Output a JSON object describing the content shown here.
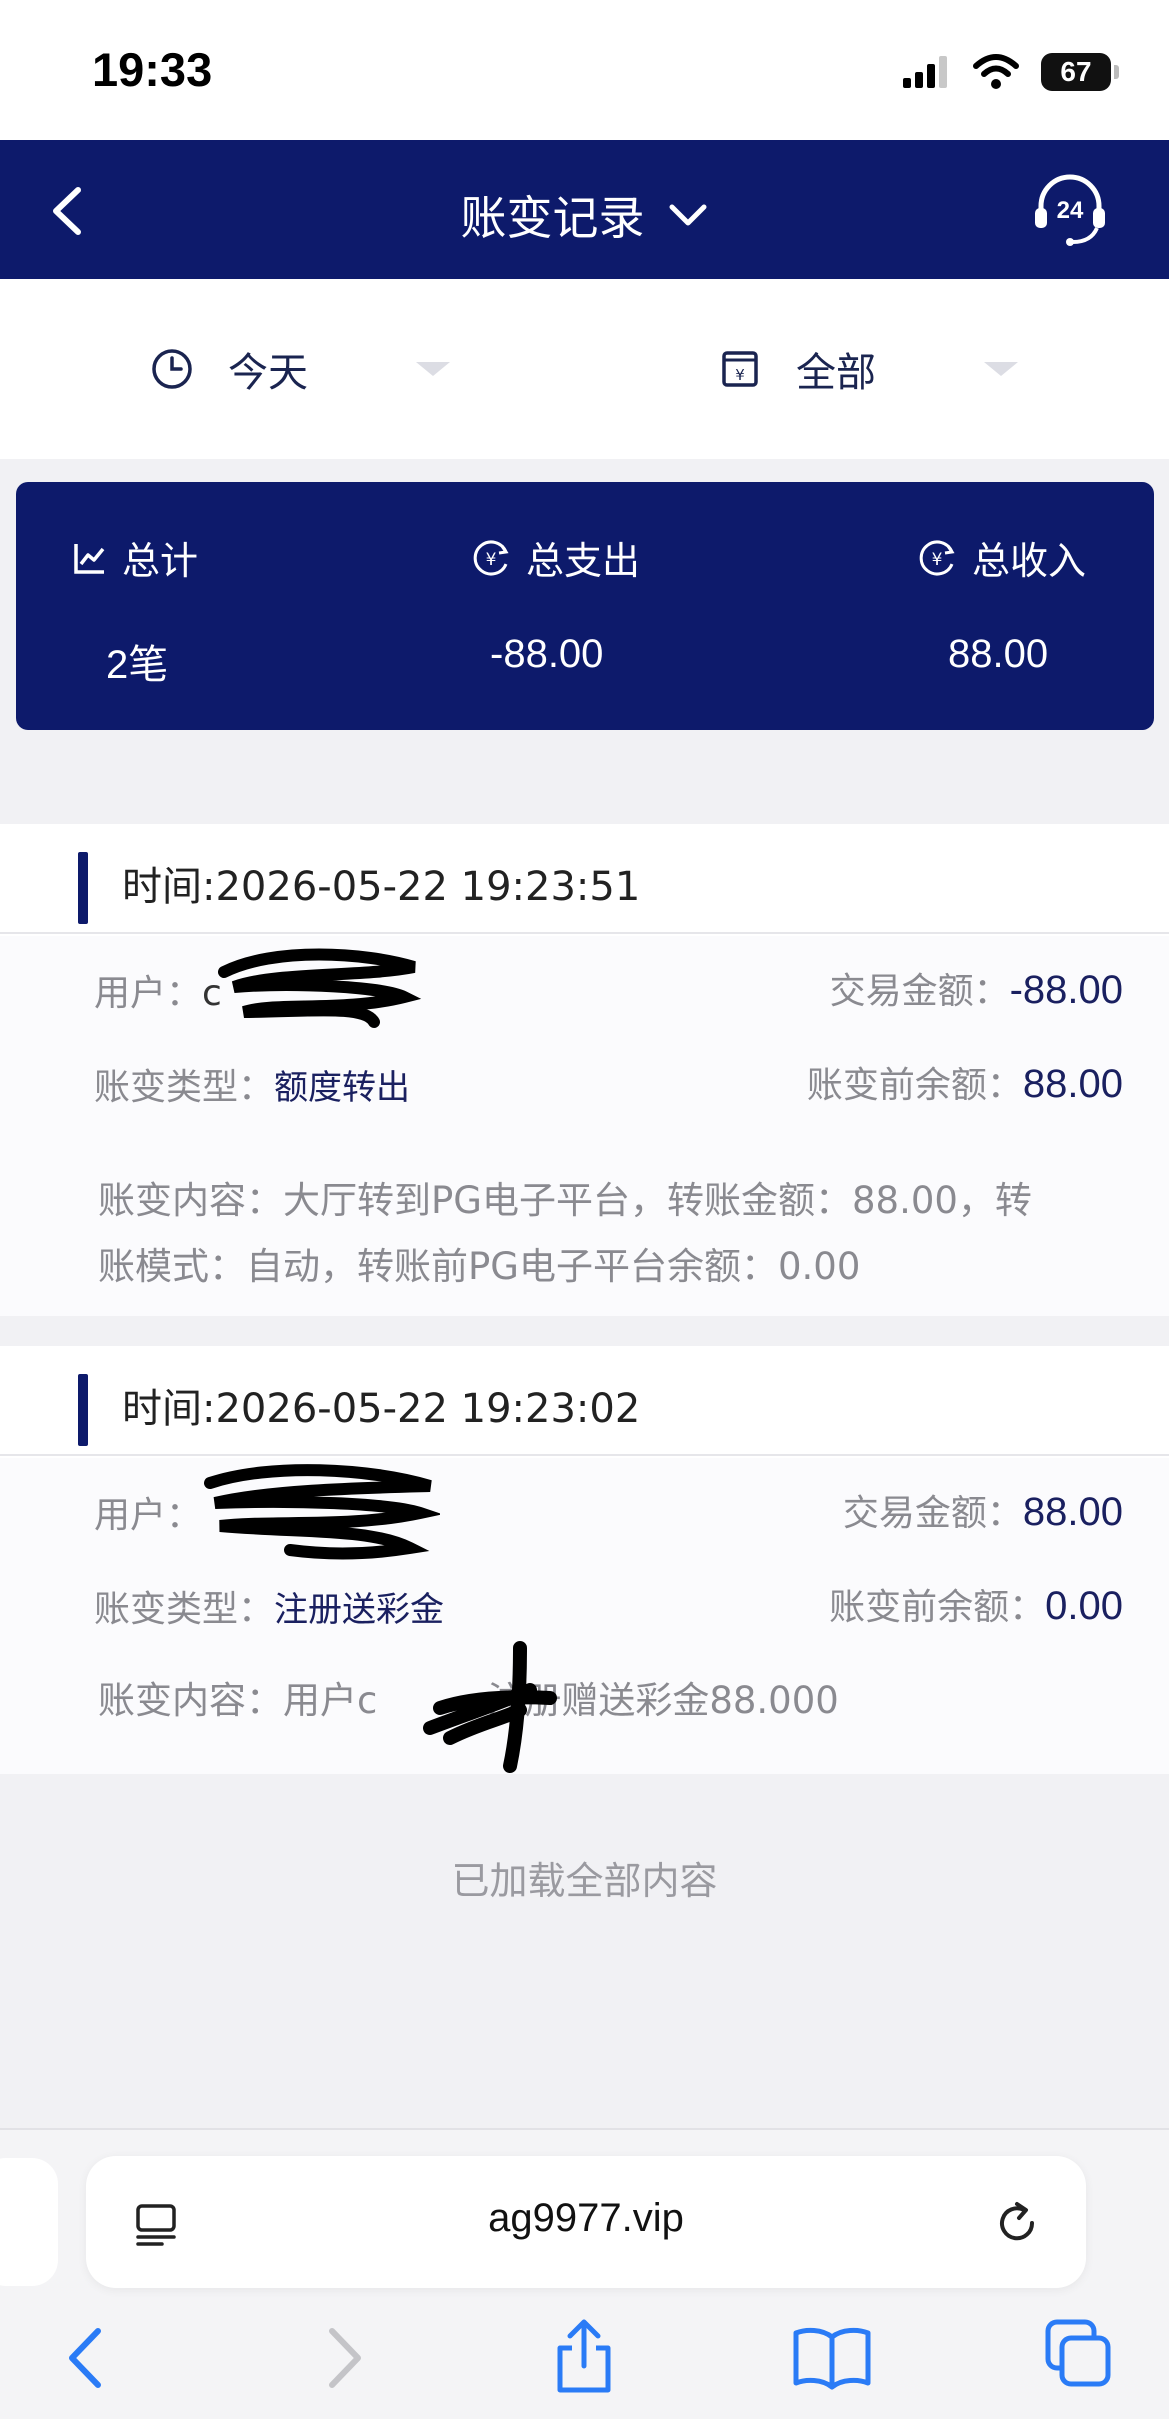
{
  "status_bar": {
    "time": "19:33",
    "battery": "67"
  },
  "header": {
    "title": "账变记录"
  },
  "filters": {
    "date_label": "今天",
    "type_label": "全部"
  },
  "summary": {
    "total_label": "总计",
    "total_value": "2笔",
    "expense_label": "总支出",
    "expense_value": "-88.00",
    "income_label": "总收入",
    "income_value": "88.00"
  },
  "records": [
    {
      "time": "时间:2026-05-22 19:23:51",
      "user_label": "用户：",
      "user_value": "c",
      "amount_label": "交易金额：",
      "amount_value": "-88.00",
      "type_label": "账变类型：",
      "type_value": "额度转出",
      "balance_label": "账变前余额：",
      "balance_value": "88.00",
      "content": "账变内容：大厅转到PG电子平台，转账金额：88.00，转账模式：自动，转账前PG电子平台余额：0.00"
    },
    {
      "time": "时间:2026-05-22 19:23:02",
      "user_label": "用户：",
      "user_value": "",
      "amount_label": "交易金额：",
      "amount_value": "88.00",
      "type_label": "账变类型：",
      "type_value": "注册送彩金",
      "balance_label": "账变前余额：",
      "balance_value": "0.00",
      "content": "账变内容：用户c",
      "content_tail": "注册赠送彩金88.000"
    }
  ],
  "footer": {
    "loaded_all": "已加载全部内容"
  },
  "browser": {
    "url": "ag9977.vip"
  },
  "icons": {
    "back": "chevron-left-icon",
    "title_caret": "chevron-down-icon",
    "support": "headset-24-icon",
    "clock": "clock-icon",
    "calendar": "calendar-yen-icon",
    "chart": "chart-line-icon",
    "yen": "yen-circle-icon",
    "reader": "reader-icon",
    "reload": "reload-icon",
    "share": "share-icon",
    "bookmarks": "book-icon",
    "tabs": "tabs-icon"
  },
  "colors": {
    "brand_navy": "#0d1a6b",
    "background": "#f1f1f4",
    "muted_text": "#8a8a90"
  }
}
